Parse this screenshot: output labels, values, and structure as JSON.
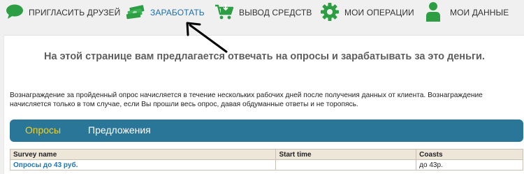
{
  "nav": {
    "items": [
      {
        "label": "ПРИГЛАСИТЬ ДРУЗЕЙ",
        "icon": "chat-bubble-icon"
      },
      {
        "label": "ЗАРАБОТАТЬ",
        "icon": "money-stack-icon"
      },
      {
        "label": "ВЫВОД СРЕДСТВ",
        "icon": "shopping-cart-icon"
      },
      {
        "label": "МОИ ОПЕРАЦИИ",
        "icon": "gear-icon"
      },
      {
        "label": "МОИ ДАННЫЕ",
        "icon": "user-icon"
      }
    ],
    "active_index": 1
  },
  "main": {
    "headline": "На этой странице вам предлагается  отвечать на опросы и зарабатывать за это деньги.",
    "description": "Вознаграждение за пройденный опрос начисляется в течение нескольких рабочих дней после получения данных от клиента. Вознаграждение начисляется только в том случае, если Вы прошли весь опрос, давая обдуманные ответы и не торопясь.",
    "tabs": [
      {
        "label": "Опросы"
      },
      {
        "label": "Предложения"
      }
    ],
    "table": {
      "headers": [
        "Survey name",
        "Start time",
        "Coasts"
      ],
      "rows": [
        {
          "name": "Опросы до 43 руб.",
          "start_time": "",
          "cost": "до 43р."
        }
      ]
    }
  },
  "colors": {
    "icon_green": "#2e9e45",
    "tab_bar": "#2a7698",
    "tab_active_text": "#f5d11c",
    "link_blue": "#1d77b8",
    "table_header_bg": "#efe6da"
  }
}
